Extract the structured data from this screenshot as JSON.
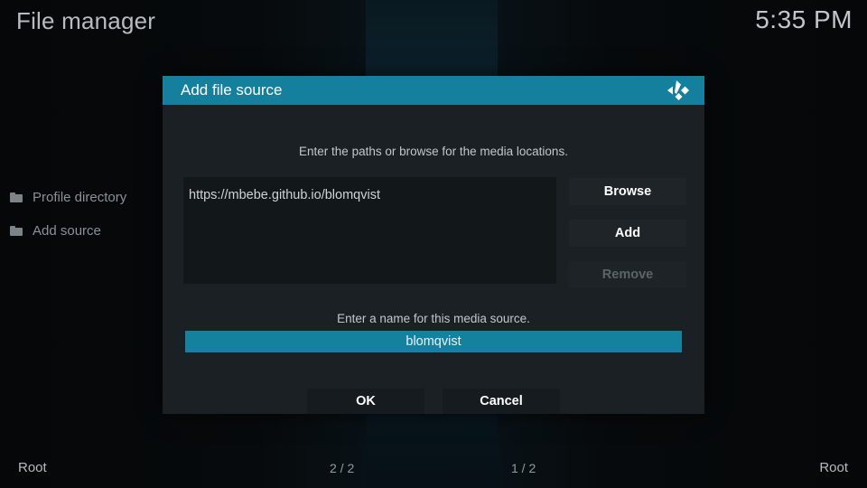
{
  "window": {
    "title": "File manager",
    "clock": "5:35 PM"
  },
  "sidebar": {
    "items": [
      {
        "label": "Profile directory",
        "icon": "folder-icon"
      },
      {
        "label": "Add source",
        "icon": "folder-icon"
      }
    ]
  },
  "dialog": {
    "title": "Add file source",
    "logo_icon": "kodi-logo-icon",
    "hint_paths": "Enter the paths or browse for the media locations.",
    "hint_name": "Enter a name for this media source.",
    "path_value": "https://mbebe.github.io/blomqvist",
    "buttons": {
      "browse": "Browse",
      "add": "Add",
      "remove": "Remove",
      "ok": "OK",
      "cancel": "Cancel"
    },
    "name_value": "blomqvist"
  },
  "statusbar": {
    "left_label": "Root",
    "left_count": "2 / 2",
    "right_count": "1 / 2",
    "right_label": "Root"
  },
  "colors": {
    "accent": "#15809e",
    "dialog_bg": "#1b2024",
    "field_bg": "#121719",
    "text": "#cfd3d6",
    "text_dim": "#8b9194",
    "disabled": "#5c6468"
  }
}
